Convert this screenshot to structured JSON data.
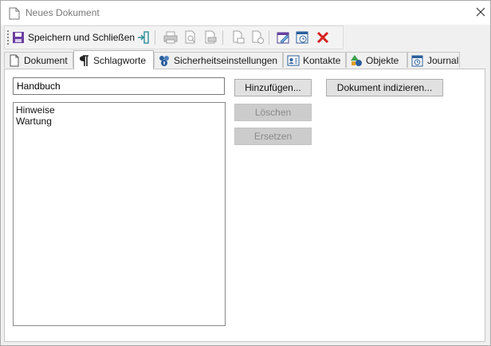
{
  "window": {
    "title": "Neues Dokument"
  },
  "toolbar": {
    "save_label": "Speichern und Schließen",
    "icons": [
      "save-icon",
      "exit-icon",
      "print-icon",
      "print-preview-icon",
      "print-setup-icon",
      "copy-icon",
      "new-copy-icon",
      "edit-icon",
      "schedule-icon",
      "delete-icon"
    ]
  },
  "tabs": [
    {
      "label": "Dokument",
      "icon": "document-icon",
      "active": false
    },
    {
      "label": "Schlagworte",
      "icon": "pilcrow-icon",
      "active": true
    },
    {
      "label": "Sicherheitseinstellungen",
      "icon": "security-users-icon",
      "active": false
    },
    {
      "label": "Kontakte",
      "icon": "contact-card-icon",
      "active": false
    },
    {
      "label": "Objekte",
      "icon": "objects-icon",
      "active": false
    },
    {
      "label": "Journal",
      "icon": "journal-icon",
      "active": false
    }
  ],
  "keywords": {
    "input_value": "Handbuch",
    "items": [
      "Hinweise",
      "Wartung"
    ],
    "add_label": "Hinzufügen...",
    "delete_label": "Löschen",
    "replace_label": "Ersetzen",
    "index_label": "Dokument indizieren..."
  },
  "colors": {
    "disabled_button": "#cccccc",
    "delete_red": "#d62020",
    "save_purple": "#6b3fa0"
  }
}
